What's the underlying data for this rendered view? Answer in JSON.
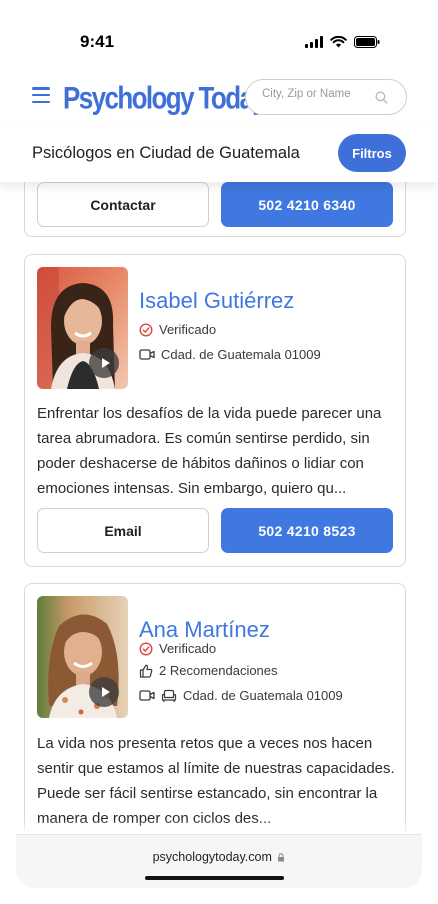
{
  "status_bar": {
    "time": "9:41"
  },
  "header": {
    "logo_text": "Psychology Today",
    "search_placeholder": "City, Zip or Name"
  },
  "subheader": {
    "title": "Psicólogos en Ciudad de Guatemala",
    "filter_label": "Filtros"
  },
  "partial_card": {
    "contact_label": "Contactar",
    "phone": "502 4210 6340"
  },
  "profiles": [
    {
      "name": "Isabel Gutiérrez",
      "verified": "Verificado",
      "location": "Cdad. de Guatemala 01009",
      "bio": "Enfrentar los desafíos de la vida puede parecer una tarea abrumadora. Es común sentirse perdido, sin poder deshacerse de hábitos dañinos o lidiar con emociones intensas. Sin embargo, quiero qu...",
      "email_label": "Email",
      "phone": "502 4210 8523"
    },
    {
      "name": "Ana Martínez",
      "verified": "Verificado",
      "recommendations": "2 Recomendaciones",
      "location": "Cdad. de Guatemala 01009",
      "bio": "La vida nos presenta retos que a veces nos hacen sentir que estamos al límite de nuestras capacidades. Puede ser fácil sentirse estancado, sin encontrar la manera de romper con ciclos des..."
    }
  ],
  "browser": {
    "url": "psychologytoday.com"
  },
  "colors": {
    "brand_blue": "#3f6fd9",
    "button_blue": "#3f78e0"
  }
}
